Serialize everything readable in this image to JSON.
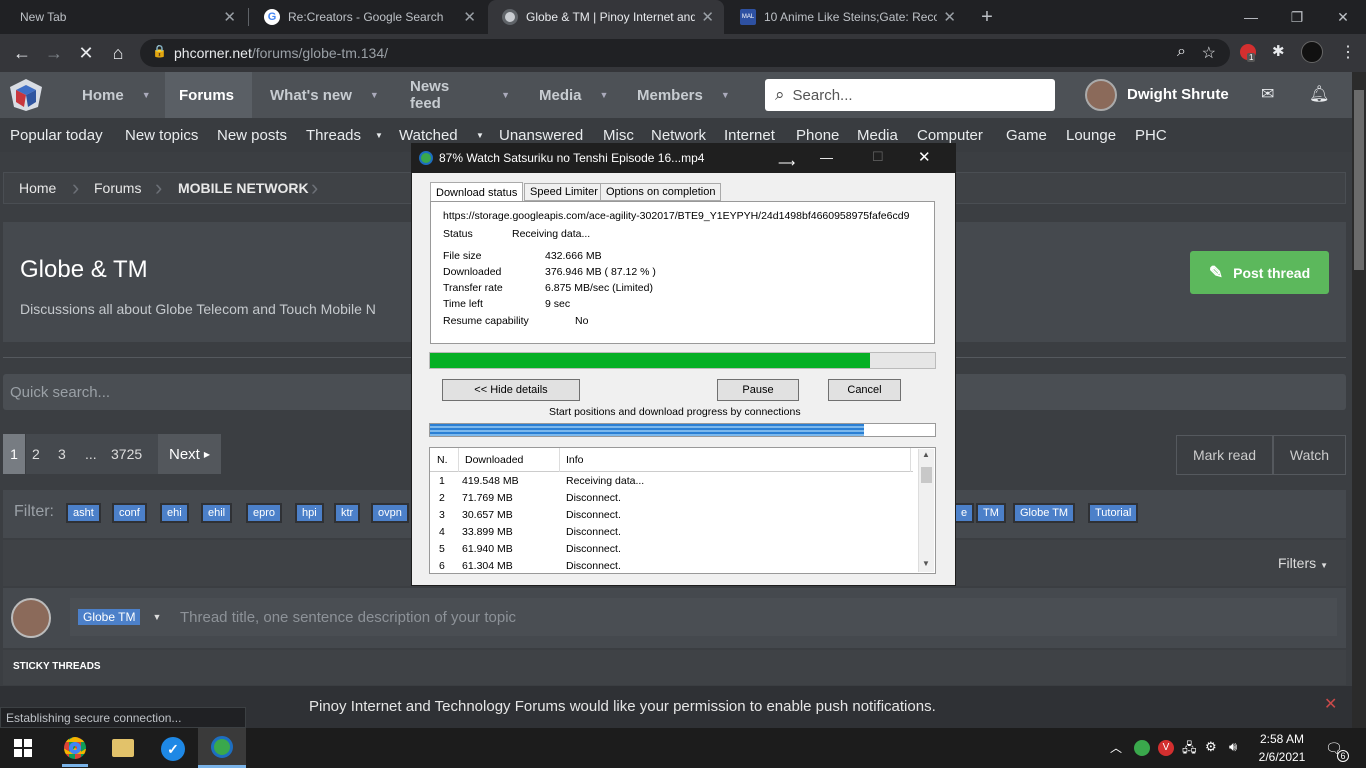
{
  "browser": {
    "tabs": [
      {
        "title": "New Tab"
      },
      {
        "title": "Re:Creators - Google Search"
      },
      {
        "title": "Globe & TM | Pinoy Internet and"
      },
      {
        "title": "10 Anime Like Steins;Gate: Recor"
      }
    ],
    "url_host": "phcorner.net",
    "url_path": "/forums/globe-tm.134/",
    "ext_badge": "1",
    "status_text": "Establishing secure connection..."
  },
  "site": {
    "nav": [
      "Home",
      "Forums",
      "What's new",
      "News feed",
      "Media",
      "Members"
    ],
    "search_placeholder": "Search...",
    "username": "Dwight Shrute",
    "subnav": [
      "Popular today",
      "New topics",
      "New posts",
      "Threads",
      "Watched",
      "Unanswered",
      "Misc",
      "Network",
      "Internet",
      "Phone",
      "Media",
      "Computer",
      "Game",
      "Lounge",
      "PHC"
    ],
    "breadcrumb": [
      "Home",
      "Forums",
      "MOBILE NETWORK"
    ],
    "forum_title": "Globe & TM",
    "forum_desc": "Discussions all about Globe Telecom and Touch Mobile N",
    "post_thread": "Post thread",
    "quick_search": "Quick search...",
    "pages": [
      "1",
      "2",
      "3",
      "...",
      "3725"
    ],
    "next": "Next",
    "mark_read": "Mark read",
    "watch": "Watch",
    "filter_label": "Filter:",
    "tags_left": [
      "asht",
      "conf",
      "ehi",
      "ehil",
      "epro",
      "hpi",
      "ktr",
      "ovpn"
    ],
    "tags_right": [
      "e",
      "TM",
      "Globe TM",
      "Tutorial"
    ],
    "filters": "Filters",
    "prefix": "Globe TM",
    "thread_placeholder": "Thread title, one sentence description of your topic",
    "sticky": "STICKY THREADS",
    "push_notice": "Pinoy Internet and Technology Forums would like your permission to enable push notifications."
  },
  "idm": {
    "title": "87% Watch Satsuriku no Tenshi Episode 16...mp4",
    "tabs": [
      "Download status",
      "Speed Limiter",
      "Options on completion"
    ],
    "url": "https://storage.googleapis.com/ace-agility-302017/BTE9_Y1EYPYH/24d1498bf4660958975fafe6cd9",
    "status_label": "Status",
    "status_value": "Receiving data...",
    "fields": [
      {
        "label": "File size",
        "value": "432.666  MB"
      },
      {
        "label": "Downloaded",
        "value": "376.946  MB  ( 87.12 % )"
      },
      {
        "label": "Transfer rate",
        "value": "6.875  MB/sec  (Limited)"
      },
      {
        "label": "Time left",
        "value": "9 sec"
      }
    ],
    "resume_label": "Resume capability",
    "resume_value": "No",
    "progress": 0.8712,
    "conn_progress": 0.86,
    "hide_details": "<< Hide details",
    "pause": "Pause",
    "cancel": "Cancel",
    "conn_caption": "Start positions and download progress by connections",
    "table_headers": [
      "N.",
      "Downloaded",
      "Info"
    ],
    "rows": [
      {
        "n": "1",
        "dl": "419.548  MB",
        "info": "Receiving data..."
      },
      {
        "n": "2",
        "dl": "71.769  MB",
        "info": "Disconnect."
      },
      {
        "n": "3",
        "dl": "30.657  MB",
        "info": "Disconnect."
      },
      {
        "n": "4",
        "dl": "33.899  MB",
        "info": "Disconnect."
      },
      {
        "n": "5",
        "dl": "61.940  MB",
        "info": "Disconnect."
      },
      {
        "n": "6",
        "dl": "61.304  MB",
        "info": "Disconnect."
      }
    ]
  },
  "taskbar": {
    "time": "2:58 AM",
    "date": "2/6/2021",
    "notif_count": "6"
  },
  "colors": {
    "accent_green": "#5cb85c",
    "tag_blue": "#4c80c9",
    "idm_progress": "#06b025"
  }
}
